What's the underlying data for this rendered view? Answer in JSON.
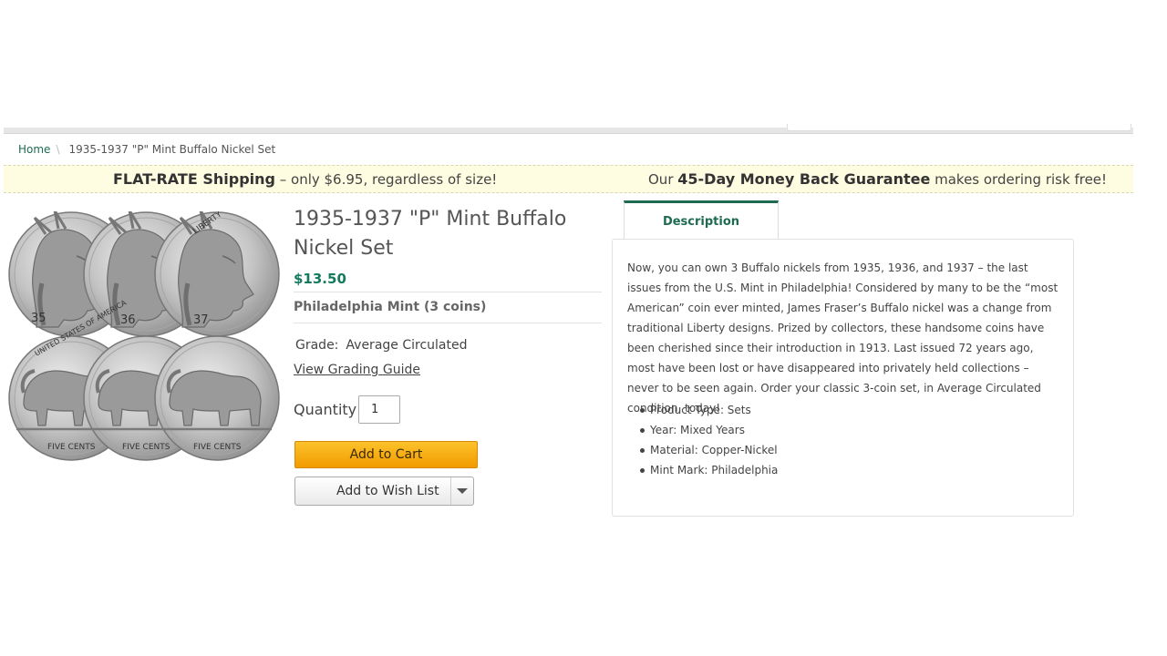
{
  "breadcrumb": {
    "home": "Home",
    "current": "1935-1937 \"P\" Mint Buffalo Nickel Set"
  },
  "promo": {
    "shipping_bold": "FLAT-RATE Shipping",
    "shipping_rest": " – only $6.95, regardless of size!",
    "guarantee_pre": "Our ",
    "guarantee_bold": "45-Day Money Back Guarantee",
    "guarantee_rest": " makes ordering risk free!"
  },
  "product": {
    "title": "1935-1937 \"P\" Mint Buffalo Nickel Set",
    "price": "$13.50",
    "variant": "Philadelphia Mint (3 coins)",
    "grade_label": "Grade:",
    "grade_value": "Average Circulated",
    "grading_guide_link": "View Grading Guide",
    "quantity_label": "Quantity",
    "quantity_value": "1",
    "add_to_cart": "Add to Cart",
    "add_to_wishlist": "Add to Wish List"
  },
  "coins": {
    "obverse_dates": [
      "35",
      "36",
      "37"
    ],
    "obverse_word": "LIBERTY",
    "reverse_top": "UNITED STATES OF AMERICA",
    "reverse_bottom": "FIVE CENTS"
  },
  "tabs": {
    "description": "Description"
  },
  "description": {
    "text": "Now, you can own 3 Buffalo nickels from 1935, 1936, and 1937 – the last issues from the U.S. Mint in Philadelphia! Considered by many to be the “most American” coin ever minted, James Fraser’s Buffalo nickel was a change from traditional Liberty designs. Prized by collectors, these handsome coins have been cherished since their introduction in 1913. Last issued 72 years ago, most have been lost or have disappeared into privately held collections – never to be seen again. Order your classic 3-coin set, in Average Circulated condition, today!",
    "specs": [
      "Product Type: Sets",
      "Year: Mixed Years",
      "Material: Copper-Nickel",
      "Mint Mark: Philadelphia"
    ]
  },
  "icons": {
    "wishlist_dropdown": "chevron-down-icon"
  },
  "colors": {
    "brand_green": "#1e6b52",
    "price_green": "#137a5e",
    "promo_bg": "#fefce1",
    "cart_orange": "#f5a800"
  }
}
